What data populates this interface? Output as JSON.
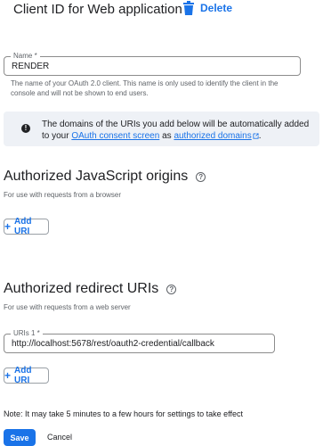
{
  "header": {
    "title": "Client ID for Web application",
    "delete_label": "Delete",
    "delete_icon": "trash-icon"
  },
  "name_field": {
    "label": "Name *",
    "value": "RENDER",
    "helper_line1": "The name of your OAuth 2.0 client. This name is only used to identify the client in the",
    "helper_line2": "console and will not be shown to end users."
  },
  "info": {
    "icon": "info-icon",
    "text_prefix": "The domains of the URIs you add below will be automatically added to your",
    "consent_link": "OAuth consent screen",
    "text_middle": "as",
    "domains_link": "authorized domains",
    "text_suffix": "."
  },
  "js_origins": {
    "title": "Authorized JavaScript origins",
    "subtitle": "For use with requests from a browser",
    "add_label": "Add URI"
  },
  "redirect_uris": {
    "title": "Authorized redirect URIs",
    "subtitle": "For use with requests from a web server",
    "uri_label": "URIs 1 *",
    "uri_value": "http://localhost:5678/rest/oauth2-credential/callback",
    "add_label": "Add URI"
  },
  "footer": {
    "note": "Note: It may take 5 minutes to a few hours for settings to take effect",
    "save_label": "Save",
    "cancel_label": "Cancel"
  },
  "colors": {
    "accent": "#1a73e8",
    "info_background": "#eef1f6",
    "text": "#202124",
    "muted_text": "#5f6368"
  }
}
